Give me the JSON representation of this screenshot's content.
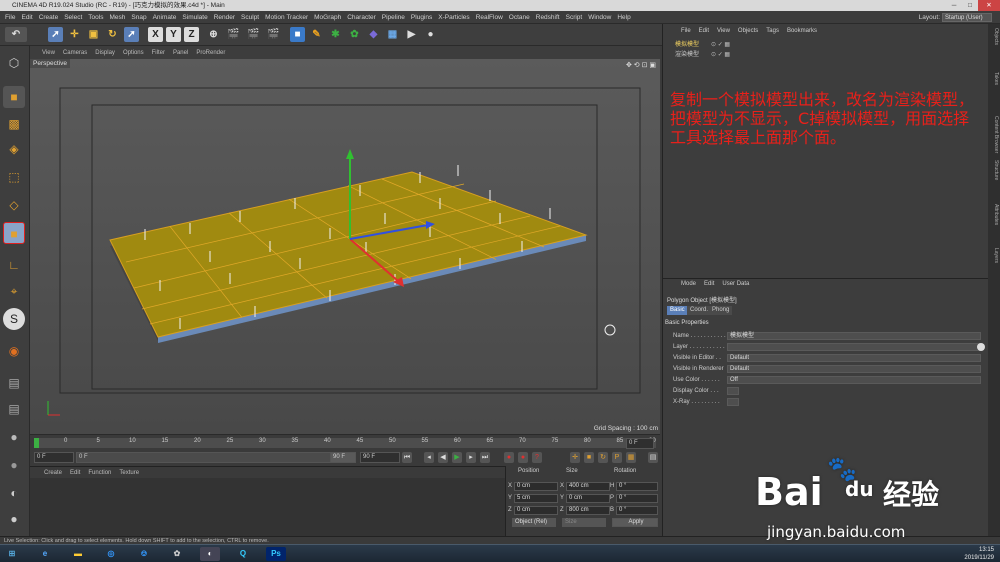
{
  "window": {
    "title": "CINEMA 4D R19.024 Studio (RC - R19) - [巧克力模拟的效果.c4d *] - Main",
    "controls": [
      "─",
      "□",
      "✕"
    ]
  },
  "menubar": {
    "items": [
      "File",
      "Edit",
      "Create",
      "Select",
      "Tools",
      "Mesh",
      "Snap",
      "Animate",
      "Simulate",
      "Render",
      "Sculpt",
      "Motion Tracker",
      "MoGraph",
      "Character",
      "Pipeline",
      "Plugins",
      "X-Particles",
      "RealFlow",
      "Octane",
      "Redshift",
      "Script",
      "Window",
      "Help"
    ],
    "layout_label": "Layout:",
    "layout_value": "Startup (User)"
  },
  "toolbar": {
    "axis": [
      "X",
      "Y",
      "Z"
    ]
  },
  "viewport": {
    "menu": [
      "View",
      "Cameras",
      "Display",
      "Options",
      "Filter",
      "Panel",
      "ProRender"
    ],
    "label": "Perspective",
    "grid_spacing": "Grid Spacing : 100 cm"
  },
  "timeline": {
    "ticks": [
      "0",
      "5",
      "10",
      "15",
      "20",
      "25",
      "30",
      "35",
      "40",
      "45",
      "50",
      "55",
      "60",
      "65",
      "70",
      "75",
      "80",
      "85",
      "90"
    ],
    "frame_end": "0 F",
    "start": "0 F",
    "cur": "0 F",
    "end1": "90 F",
    "end2": "90 F"
  },
  "material": {
    "menu": [
      "Create",
      "Edit",
      "Function",
      "Texture"
    ]
  },
  "coords": {
    "headers": [
      "Position",
      "Size",
      "Rotation"
    ],
    "rows": [
      {
        "axis": "X",
        "pos": "0 cm",
        "size": "400 cm",
        "rl": "H",
        "rot": "0 °"
      },
      {
        "axis": "Y",
        "pos": "5 cm",
        "size": "0 cm",
        "rl": "P",
        "rot": "0 °"
      },
      {
        "axis": "Z",
        "pos": "0 cm",
        "size": "800 cm",
        "rl": "B",
        "rot": "0 °"
      }
    ],
    "mode": "Object (Rel)",
    "size_mode": "Size",
    "apply": "Apply"
  },
  "objects": {
    "menu": [
      "File",
      "Edit",
      "View",
      "Objects",
      "Tags",
      "Bookmarks"
    ],
    "items": [
      "模拟模型",
      "渲染模型"
    ]
  },
  "annotation": "复制一个模拟模型出来，改名为渲染模型，把模型为不显示，C掉模拟模型，用面选择工具选择最上面那个面。",
  "attributes": {
    "menu": [
      "Mode",
      "Edit",
      "User Data"
    ],
    "object_title": "Polygon Object [模拟模型]",
    "tabs": [
      "Basic",
      "Coord.",
      "Phong"
    ],
    "section": "Basic Properties",
    "fields": [
      {
        "label": "Name . . . . . . . . . . .",
        "value": "模拟模型"
      },
      {
        "label": "Layer . . . . . . . . . . .",
        "value": ""
      },
      {
        "label": "Visible in Editor . .",
        "value": "Default"
      },
      {
        "label": "Visible in Renderer",
        "value": "Default"
      },
      {
        "label": "Use Color . . . . . .",
        "value": "Off"
      },
      {
        "label": "Display Color . . .",
        "value": ""
      },
      {
        "label": "X-Ray . . . . . . . . .",
        "value": ""
      }
    ]
  },
  "right_tabs": [
    "Objects",
    "Takes",
    "Content Browser",
    "Structure",
    "Attributes",
    "Layers"
  ],
  "statusbar": "Live Selection: Click and drag to select elements. Hold down SHIFT to add to the selection, CTRL to remove.",
  "clock": {
    "time": "13:15",
    "date": "2019/11/29"
  },
  "watermark": {
    "brand": "Bai",
    "brand2": "du",
    "cn": "经验",
    "url": "jingyan.baidu.com"
  }
}
